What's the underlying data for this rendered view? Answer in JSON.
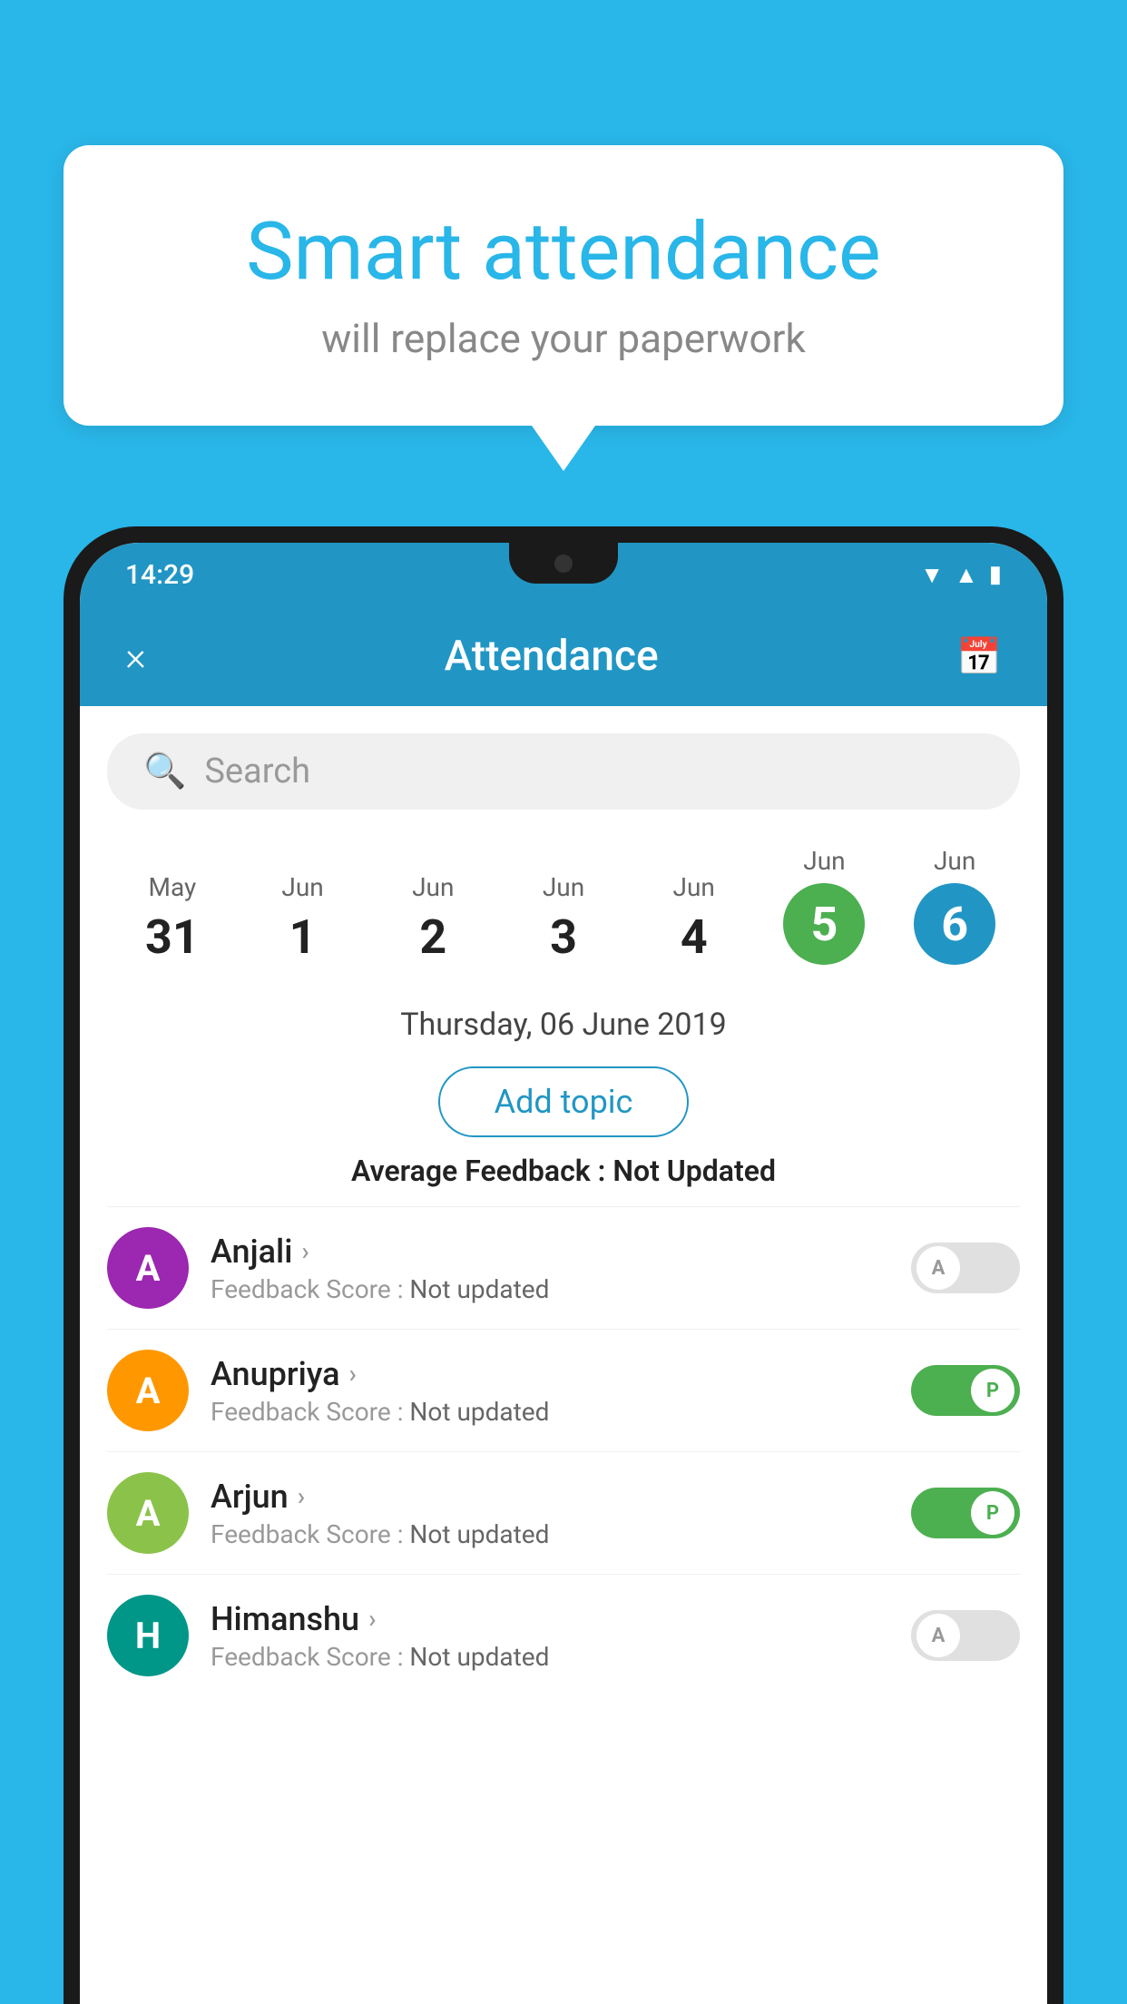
{
  "background_color": "#29b6e8",
  "speech_bubble": {
    "title": "Smart attendance",
    "subtitle": "will replace your paperwork"
  },
  "status_bar": {
    "time": "14:29",
    "icons": [
      "wifi",
      "signal",
      "battery"
    ]
  },
  "app_header": {
    "title": "Attendance",
    "close_label": "×",
    "calendar_icon": "📅"
  },
  "search": {
    "placeholder": "Search"
  },
  "dates": [
    {
      "month": "May",
      "day": "31",
      "selected": false
    },
    {
      "month": "Jun",
      "day": "1",
      "selected": false
    },
    {
      "month": "Jun",
      "day": "2",
      "selected": false
    },
    {
      "month": "Jun",
      "day": "3",
      "selected": false
    },
    {
      "month": "Jun",
      "day": "4",
      "selected": false
    },
    {
      "month": "Jun",
      "day": "5",
      "selected": "green"
    },
    {
      "month": "Jun",
      "day": "6",
      "selected": "blue"
    }
  ],
  "selected_date_label": "Thursday, 06 June 2019",
  "add_topic_label": "Add topic",
  "average_feedback_label": "Average Feedback : ",
  "average_feedback_value": "Not Updated",
  "students": [
    {
      "name": "Anjali",
      "avatar_letter": "A",
      "avatar_color": "avatar-purple",
      "feedback": "Feedback Score : Not updated",
      "attendance": "absent",
      "toggle_letter": "A"
    },
    {
      "name": "Anupriya",
      "avatar_letter": "A",
      "avatar_color": "avatar-orange",
      "feedback": "Feedback Score : Not updated",
      "attendance": "present",
      "toggle_letter": "P"
    },
    {
      "name": "Arjun",
      "avatar_letter": "A",
      "avatar_color": "avatar-green-light",
      "feedback": "Feedback Score : Not updated",
      "attendance": "present",
      "toggle_letter": "P"
    },
    {
      "name": "Himanshu",
      "avatar_letter": "H",
      "avatar_color": "avatar-teal",
      "feedback": "Feedback Score : Not updated",
      "attendance": "absent",
      "toggle_letter": "A"
    }
  ]
}
